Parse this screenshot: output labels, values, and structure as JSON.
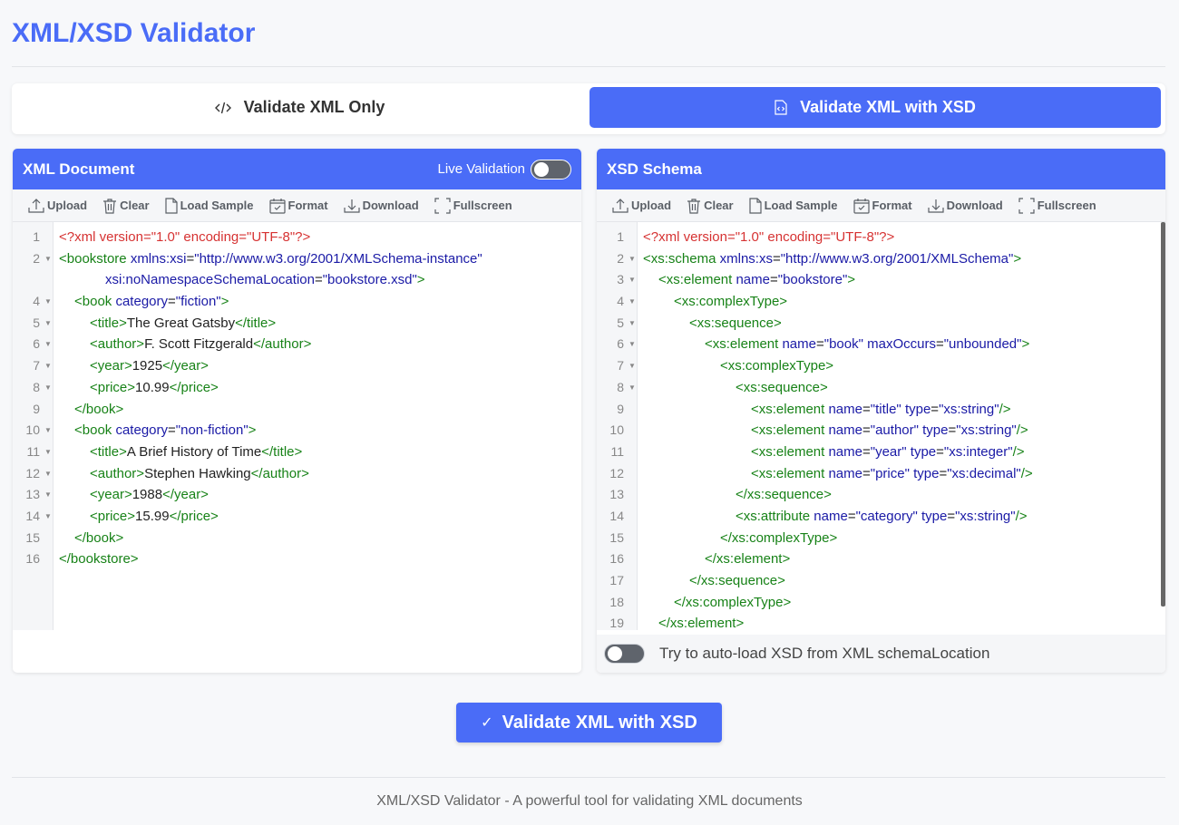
{
  "app": {
    "title": "XML/XSD Validator"
  },
  "modes": {
    "xml_only": "Validate XML Only",
    "xml_xsd": "Validate XML with XSD"
  },
  "xml_panel": {
    "title": "XML Document",
    "live_validation": "Live Validation",
    "toolbar": {
      "upload": "Upload",
      "clear": "Clear",
      "load_sample": "Load Sample",
      "format": "Format",
      "download": "Download",
      "fullscreen": "Fullscreen"
    },
    "lines": [
      {
        "n": "1",
        "fold": false,
        "indent": 0,
        "tokens": [
          [
            "pi",
            "<?xml version=\"1.0\" encoding=\"UTF-8\"?>"
          ]
        ]
      },
      {
        "n": "2",
        "fold": true,
        "indent": 0,
        "tokens": [
          [
            "tag",
            "<bookstore "
          ],
          [
            "attr",
            "xmlns:xsi"
          ],
          [
            "text",
            "="
          ],
          [
            "val",
            "\"http://www.w3.org/2001/XMLSchema-instance\""
          ]
        ]
      },
      {
        "n": "",
        "fold": false,
        "indent": 3,
        "tokens": [
          [
            "attr",
            "xsi:noNamespaceSchemaLocation"
          ],
          [
            "text",
            "="
          ],
          [
            "val",
            "\"bookstore.xsd\""
          ],
          [
            "tag",
            ">"
          ]
        ]
      },
      {
        "n": "4",
        "fold": true,
        "indent": 1,
        "tokens": [
          [
            "tag",
            "<book "
          ],
          [
            "attr",
            "category"
          ],
          [
            "text",
            "="
          ],
          [
            "val",
            "\"fiction\""
          ],
          [
            "tag",
            ">"
          ]
        ]
      },
      {
        "n": "5",
        "fold": true,
        "indent": 2,
        "tokens": [
          [
            "tag",
            "<title>"
          ],
          [
            "text",
            "The Great Gatsby"
          ],
          [
            "tag",
            "</title>"
          ]
        ]
      },
      {
        "n": "6",
        "fold": true,
        "indent": 2,
        "tokens": [
          [
            "tag",
            "<author>"
          ],
          [
            "text",
            "F. Scott Fitzgerald"
          ],
          [
            "tag",
            "</author>"
          ]
        ]
      },
      {
        "n": "7",
        "fold": true,
        "indent": 2,
        "tokens": [
          [
            "tag",
            "<year>"
          ],
          [
            "text",
            "1925"
          ],
          [
            "tag",
            "</year>"
          ]
        ]
      },
      {
        "n": "8",
        "fold": true,
        "indent": 2,
        "tokens": [
          [
            "tag",
            "<price>"
          ],
          [
            "text",
            "10.99"
          ],
          [
            "tag",
            "</price>"
          ]
        ]
      },
      {
        "n": "9",
        "fold": false,
        "indent": 1,
        "tokens": [
          [
            "tag",
            "</book>"
          ]
        ]
      },
      {
        "n": "10",
        "fold": true,
        "indent": 1,
        "tokens": [
          [
            "tag",
            "<book "
          ],
          [
            "attr",
            "category"
          ],
          [
            "text",
            "="
          ],
          [
            "val",
            "\"non-fiction\""
          ],
          [
            "tag",
            ">"
          ]
        ]
      },
      {
        "n": "11",
        "fold": true,
        "indent": 2,
        "tokens": [
          [
            "tag",
            "<title>"
          ],
          [
            "text",
            "A Brief History of Time"
          ],
          [
            "tag",
            "</title>"
          ]
        ]
      },
      {
        "n": "12",
        "fold": true,
        "indent": 2,
        "tokens": [
          [
            "tag",
            "<author>"
          ],
          [
            "text",
            "Stephen Hawking"
          ],
          [
            "tag",
            "</author>"
          ]
        ]
      },
      {
        "n": "13",
        "fold": true,
        "indent": 2,
        "tokens": [
          [
            "tag",
            "<year>"
          ],
          [
            "text",
            "1988"
          ],
          [
            "tag",
            "</year>"
          ]
        ]
      },
      {
        "n": "14",
        "fold": true,
        "indent": 2,
        "tokens": [
          [
            "tag",
            "<price>"
          ],
          [
            "text",
            "15.99"
          ],
          [
            "tag",
            "</price>"
          ]
        ]
      },
      {
        "n": "15",
        "fold": false,
        "indent": 1,
        "tokens": [
          [
            "tag",
            "</book>"
          ]
        ]
      },
      {
        "n": "16",
        "fold": false,
        "indent": 0,
        "tokens": [
          [
            "tag",
            "</bookstore>"
          ]
        ]
      }
    ]
  },
  "xsd_panel": {
    "title": "XSD Schema",
    "toolbar": {
      "upload": "Upload",
      "clear": "Clear",
      "load_sample": "Load Sample",
      "format": "Format",
      "download": "Download",
      "fullscreen": "Fullscreen"
    },
    "auto_load": "Try to auto-load XSD from XML schemaLocation",
    "lines": [
      {
        "n": "1",
        "fold": false,
        "indent": 0,
        "tokens": [
          [
            "pi",
            "<?xml version=\"1.0\" encoding=\"UTF-8\"?>"
          ]
        ]
      },
      {
        "n": "2",
        "fold": true,
        "indent": 0,
        "tokens": [
          [
            "tag",
            "<xs:schema "
          ],
          [
            "attr",
            "xmlns:xs"
          ],
          [
            "text",
            "="
          ],
          [
            "val",
            "\"http://www.w3.org/2001/XMLSchema\""
          ],
          [
            "tag",
            ">"
          ]
        ]
      },
      {
        "n": "3",
        "fold": true,
        "indent": 1,
        "tokens": [
          [
            "tag",
            "<xs:element "
          ],
          [
            "attr",
            "name"
          ],
          [
            "text",
            "="
          ],
          [
            "val",
            "\"bookstore\""
          ],
          [
            "tag",
            ">"
          ]
        ]
      },
      {
        "n": "4",
        "fold": true,
        "indent": 2,
        "tokens": [
          [
            "tag",
            "<xs:complexType>"
          ]
        ]
      },
      {
        "n": "5",
        "fold": true,
        "indent": 3,
        "tokens": [
          [
            "tag",
            "<xs:sequence>"
          ]
        ]
      },
      {
        "n": "6",
        "fold": true,
        "indent": 4,
        "tokens": [
          [
            "tag",
            "<xs:element "
          ],
          [
            "attr",
            "name"
          ],
          [
            "text",
            "="
          ],
          [
            "val",
            "\"book\""
          ],
          [
            "text",
            " "
          ],
          [
            "attr",
            "maxOccurs"
          ],
          [
            "text",
            "="
          ],
          [
            "val",
            "\"unbounded\""
          ],
          [
            "tag",
            ">"
          ]
        ]
      },
      {
        "n": "7",
        "fold": true,
        "indent": 5,
        "tokens": [
          [
            "tag",
            "<xs:complexType>"
          ]
        ]
      },
      {
        "n": "8",
        "fold": true,
        "indent": 6,
        "tokens": [
          [
            "tag",
            "<xs:sequence>"
          ]
        ]
      },
      {
        "n": "9",
        "fold": false,
        "indent": 7,
        "tokens": [
          [
            "tag",
            "<xs:element "
          ],
          [
            "attr",
            "name"
          ],
          [
            "text",
            "="
          ],
          [
            "val",
            "\"title\""
          ],
          [
            "text",
            " "
          ],
          [
            "attr",
            "type"
          ],
          [
            "text",
            "="
          ],
          [
            "val",
            "\"xs:string\""
          ],
          [
            "tag",
            "/>"
          ]
        ]
      },
      {
        "n": "10",
        "fold": false,
        "indent": 7,
        "tokens": [
          [
            "tag",
            "<xs:element "
          ],
          [
            "attr",
            "name"
          ],
          [
            "text",
            "="
          ],
          [
            "val",
            "\"author\""
          ],
          [
            "text",
            " "
          ],
          [
            "attr",
            "type"
          ],
          [
            "text",
            "="
          ],
          [
            "val",
            "\"xs:string\""
          ],
          [
            "tag",
            "/>"
          ]
        ]
      },
      {
        "n": "11",
        "fold": false,
        "indent": 7,
        "tokens": [
          [
            "tag",
            "<xs:element "
          ],
          [
            "attr",
            "name"
          ],
          [
            "text",
            "="
          ],
          [
            "val",
            "\"year\""
          ],
          [
            "text",
            " "
          ],
          [
            "attr",
            "type"
          ],
          [
            "text",
            "="
          ],
          [
            "val",
            "\"xs:integer\""
          ],
          [
            "tag",
            "/>"
          ]
        ]
      },
      {
        "n": "12",
        "fold": false,
        "indent": 7,
        "tokens": [
          [
            "tag",
            "<xs:element "
          ],
          [
            "attr",
            "name"
          ],
          [
            "text",
            "="
          ],
          [
            "val",
            "\"price\""
          ],
          [
            "text",
            " "
          ],
          [
            "attr",
            "type"
          ],
          [
            "text",
            "="
          ],
          [
            "val",
            "\"xs:decimal\""
          ],
          [
            "tag",
            "/>"
          ]
        ]
      },
      {
        "n": "13",
        "fold": false,
        "indent": 6,
        "tokens": [
          [
            "tag",
            "</xs:sequence>"
          ]
        ]
      },
      {
        "n": "14",
        "fold": false,
        "indent": 6,
        "tokens": [
          [
            "tag",
            "<xs:attribute "
          ],
          [
            "attr",
            "name"
          ],
          [
            "text",
            "="
          ],
          [
            "val",
            "\"category\""
          ],
          [
            "text",
            " "
          ],
          [
            "attr",
            "type"
          ],
          [
            "text",
            "="
          ],
          [
            "val",
            "\"xs:string\""
          ],
          [
            "tag",
            "/>"
          ]
        ]
      },
      {
        "n": "15",
        "fold": false,
        "indent": 5,
        "tokens": [
          [
            "tag",
            "</xs:complexType>"
          ]
        ]
      },
      {
        "n": "16",
        "fold": false,
        "indent": 4,
        "tokens": [
          [
            "tag",
            "</xs:element>"
          ]
        ]
      },
      {
        "n": "17",
        "fold": false,
        "indent": 3,
        "tokens": [
          [
            "tag",
            "</xs:sequence>"
          ]
        ]
      },
      {
        "n": "18",
        "fold": false,
        "indent": 2,
        "tokens": [
          [
            "tag",
            "</xs:complexType>"
          ]
        ]
      },
      {
        "n": "19",
        "fold": false,
        "indent": 1,
        "tokens": [
          [
            "tag",
            "</xs:element>"
          ]
        ]
      }
    ]
  },
  "validate_button": "Validate XML with XSD",
  "footer": "XML/XSD Validator - A powerful tool for validating XML documents",
  "colors": {
    "accent": "#4a6cf7",
    "pi": "#d63232",
    "tag": "#178217",
    "attr": "#1a1aa6"
  }
}
